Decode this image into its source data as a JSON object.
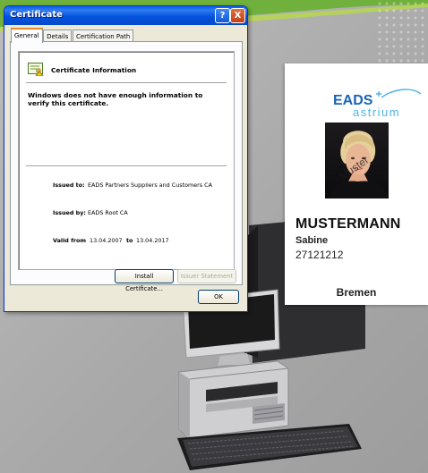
{
  "window": {
    "title": "Certificate",
    "help_button": "?",
    "close_button": "X",
    "tabs": [
      {
        "label": "General",
        "active": true
      },
      {
        "label": "Details",
        "active": false
      },
      {
        "label": "Certification Path",
        "active": false
      }
    ],
    "info_title": "Certificate Information",
    "message": "Windows does not have enough information to verify this certificate.",
    "issued_to_label": "Issued to:",
    "issued_to_value": "EADS Partners Suppliers and Customers CA",
    "issued_by_label": "Issued by:",
    "issued_by_value": "EADS Root CA",
    "valid_from_label": "Valid from",
    "valid_from_value": "13.04.2007",
    "valid_to_label": "to",
    "valid_to_value": "13.04.2017",
    "install_button": "Install Certificate...",
    "issuer_statement_button": "Issuer Statement",
    "ok_button": "OK"
  },
  "idcard": {
    "logo_top": "EADS",
    "logo_bottom": "astrium",
    "photo_watermark": "Muster",
    "surname": "MUSTERMANN",
    "firstname": "Sabine",
    "number": "27121212",
    "city": "Bremen"
  },
  "colors": {
    "titlebar": "#0553dd",
    "window_bg": "#ece9d8",
    "logo_blue": "#1a64b3",
    "logo_cyan": "#4db3e6"
  }
}
